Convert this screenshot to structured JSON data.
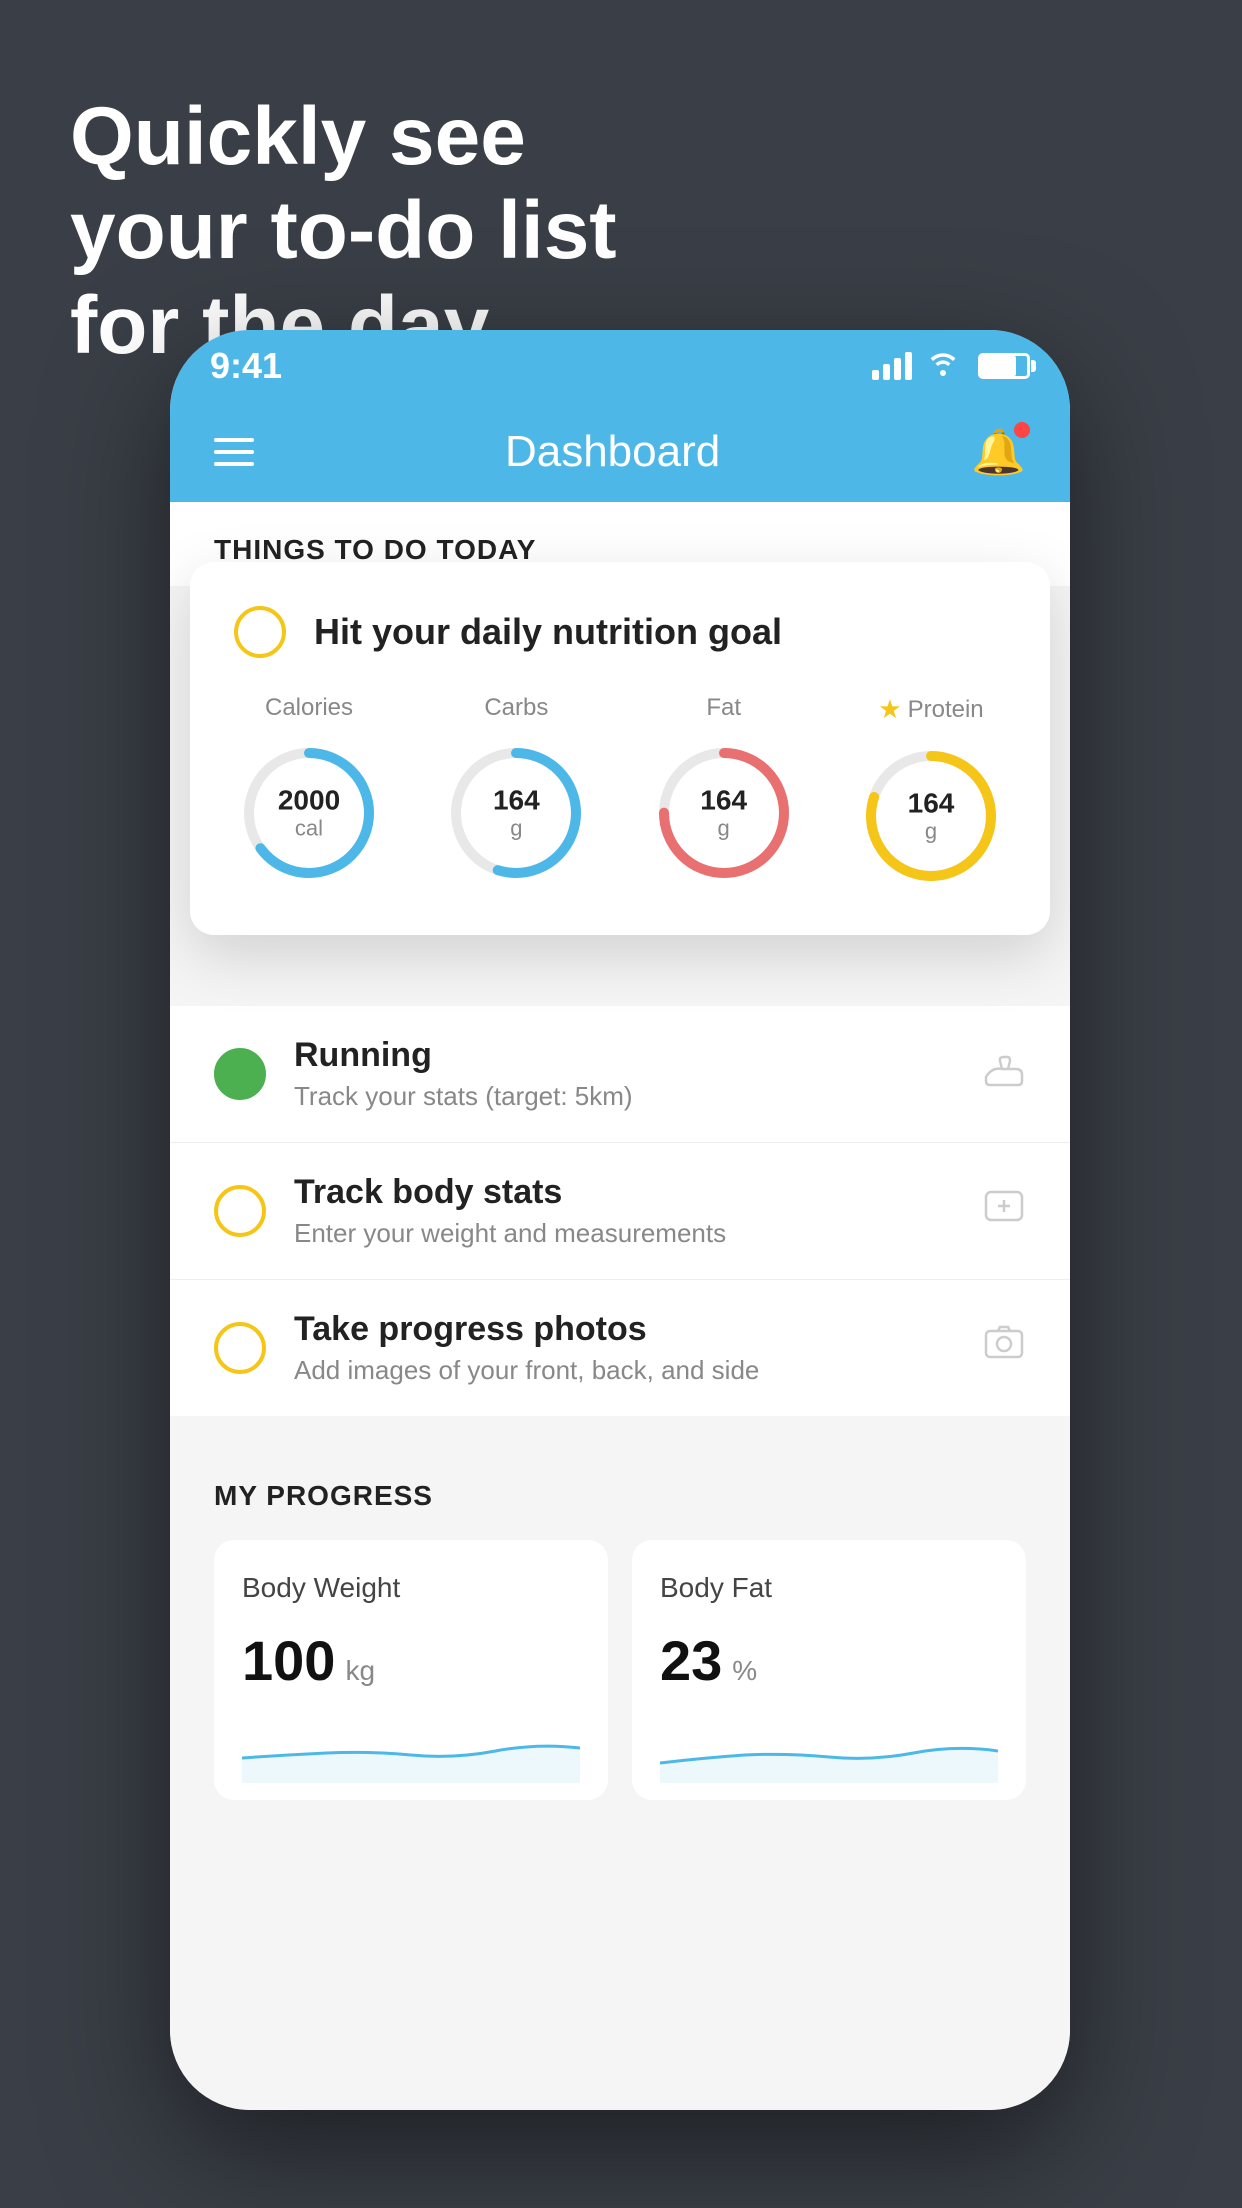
{
  "headline": {
    "line1": "Quickly see",
    "line2": "your to-do list",
    "line3": "for the day."
  },
  "statusBar": {
    "time": "9:41"
  },
  "header": {
    "title": "Dashboard"
  },
  "sectionLabel": "THINGS TO DO TODAY",
  "floatingCard": {
    "title": "Hit your daily nutrition goal",
    "nutrition": [
      {
        "label": "Calories",
        "value": "2000",
        "unit": "cal",
        "color": "#4db8e8",
        "pct": 65,
        "star": false
      },
      {
        "label": "Carbs",
        "value": "164",
        "unit": "g",
        "color": "#4db8e8",
        "pct": 55,
        "star": false
      },
      {
        "label": "Fat",
        "value": "164",
        "unit": "g",
        "color": "#e87070",
        "pct": 75,
        "star": false
      },
      {
        "label": "Protein",
        "value": "164",
        "unit": "g",
        "color": "#f5c518",
        "pct": 80,
        "star": true
      }
    ]
  },
  "todoItems": [
    {
      "title": "Running",
      "subtitle": "Track your stats (target: 5km)",
      "iconLabel": "shoe-icon",
      "checkColor": "green"
    },
    {
      "title": "Track body stats",
      "subtitle": "Enter your weight and measurements",
      "iconLabel": "scale-icon",
      "checkColor": "yellow"
    },
    {
      "title": "Take progress photos",
      "subtitle": "Add images of your front, back, and side",
      "iconLabel": "photo-icon",
      "checkColor": "yellow"
    }
  ],
  "progressSection": {
    "title": "MY PROGRESS",
    "cards": [
      {
        "title": "Body Weight",
        "value": "100",
        "unit": "kg"
      },
      {
        "title": "Body Fat",
        "value": "23",
        "unit": "%"
      }
    ]
  }
}
